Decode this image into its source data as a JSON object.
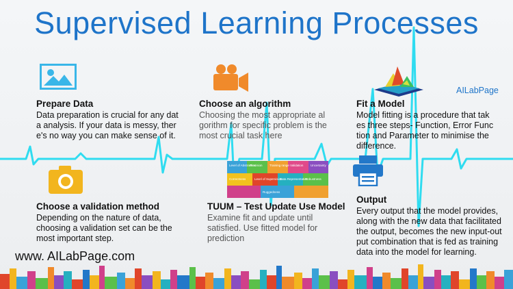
{
  "title": "Supervised Learning Processes",
  "brand": "AILabPage",
  "website": "www. AILabPage.com",
  "sections": {
    "prepare_data": {
      "heading": "Prepare Data",
      "lines": [
        "Data preparation is crucial for any dat",
        "a analysis. If your data is messy, ther",
        "e's no way you can make sense of it."
      ]
    },
    "choose_algorithm": {
      "heading": "Choose an algorithm",
      "lines": [
        "Choosing the most appropriate al",
        "gorithm for specific problem is the",
        "most crucial task here"
      ]
    },
    "fit_model": {
      "heading": "Fit a Model",
      "lines": [
        "Model fitting is a procedure that tak",
        "es three steps- Function, Error Func",
        "tion and Parameter to minimise the",
        "difference."
      ]
    },
    "validation": {
      "heading": "Choose a validation method",
      "lines": [
        "Depending on the nature of data,",
        "choosing a validation set can be the",
        "most important step."
      ]
    },
    "tuum": {
      "heading": "TUUM – Test Update Use Model",
      "lines": [
        "Examine fit and update until",
        "satisfied. Use fitted model for",
        "prediction"
      ]
    },
    "output": {
      "heading": "Output",
      "lines": [
        "Every output that the model provides,",
        "along with the new data that facilitated",
        "the output, becomes the new input-out",
        "put combination that is fed as training",
        "data into the model for learning."
      ]
    }
  },
  "puzzle": {
    "pieces": [
      "Level of Abstraction",
      "Precision",
      "Training range",
      "Validation",
      "Uncertainty",
      "Correctness",
      "Level of Supervision",
      "Data Representation",
      "Robustness",
      "Ruggedness"
    ]
  },
  "colors": {
    "title_blue": "#1e74c9",
    "pulse_cyan": "#19d9f0",
    "icon_sky": "#39b6e8",
    "icon_orange": "#f08a2b",
    "icon_yellow": "#f2b51e",
    "icon_blue": "#2378c9"
  },
  "icons": {
    "prepare_data": "image-icon",
    "choose_algorithm": "video-camera-icon",
    "fit_model": "3d-surface-plot",
    "validation": "camera-icon",
    "tuum": "puzzle-image",
    "output": "printer-icon"
  }
}
